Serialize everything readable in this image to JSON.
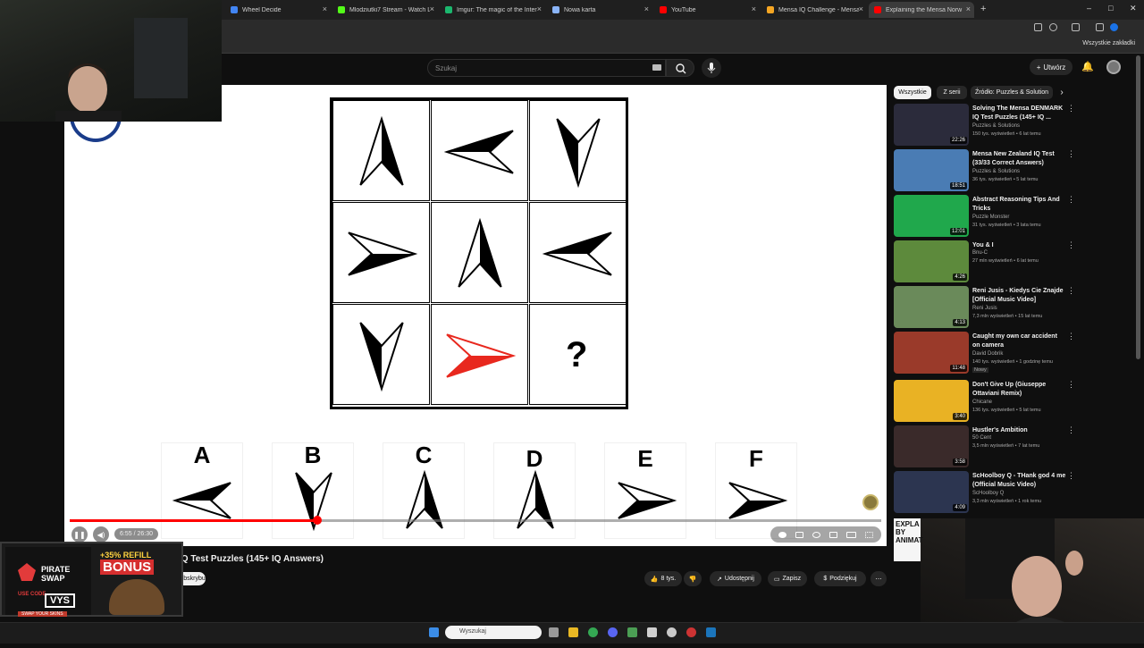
{
  "browser": {
    "tabs": [
      {
        "title": "Wheel Decide",
        "color": "#4285f4"
      },
      {
        "title": "Mlodziutki7 Stream - Watch Li",
        "color": "#53fc18"
      },
      {
        "title": "Imgur: The magic of the Intern",
        "color": "#1bb76e"
      },
      {
        "title": "Nowa karta",
        "color": "#8ab4f8"
      },
      {
        "title": "YouTube",
        "color": "#ff0000"
      },
      {
        "title": "Mensa IQ Challenge - Mensa I",
        "color": "#f5a623"
      },
      {
        "title": "Explaining the Mensa Norw",
        "color": "#ff0000"
      }
    ],
    "new_tab": "+",
    "window_controls": [
      "–",
      "□",
      "✕"
    ],
    "bookmarks_all": "Wszystkie zakładki"
  },
  "youtube": {
    "search_placeholder": "Szukaj",
    "create_label": "Utwórz",
    "create_icon": "+",
    "bell_icon": "🔔"
  },
  "player": {
    "time": "6:55 / 26:30",
    "progress": 0.305,
    "play_icon": "❚❚",
    "volume_icon": "◀)",
    "question_mark": "?",
    "options": [
      "A",
      "B",
      "C",
      "D",
      "E",
      "F"
    ],
    "accent_red": "#e8281e"
  },
  "video": {
    "title": "Mensa Norway IQ Test Puzzles (145+ IQ Answers)",
    "title_visible": "IQ Test Puzzles (145+ IQ Answers)",
    "subscribe": "Subskrybuj",
    "likes": "8 tys.",
    "dislike_icon": "👎",
    "like_icon": "👍",
    "share": "Udostępnij",
    "save": "Zapisz",
    "thanks": "Podziękuj",
    "more": "⋯"
  },
  "sidebar": {
    "chips": [
      "Wszystkie",
      "Z serii",
      "Źródło: Puzzles & Solution"
    ],
    "next_icon": "›",
    "items": [
      {
        "title": "Solving The Mensa DENMARK IQ Test Puzzles (145+ IQ ...",
        "channel": "Puzzles & Solutions",
        "meta": "150 tys. wyświetleń • 6 lat temu",
        "duration": "22:26",
        "thumb": "#2b2b3b"
      },
      {
        "title": "Mensa New Zealand IQ Test (33/33 Correct Answers)",
        "channel": "Puzzles & Solutions",
        "meta": "36 tys. wyświetleń • 5 lat temu",
        "duration": "18:51",
        "thumb": "#4a7cb4"
      },
      {
        "title": "Abstract Reasoning Tips And Tricks",
        "channel": "Puzzle Monster",
        "meta": "31 tys. wyświetleń • 3 lata temu",
        "duration": "12:01",
        "thumb": "#20a84c"
      },
      {
        "title": "You & I",
        "channel": "Bnu-C",
        "meta": "27 mln wyświetleń • 6 lat temu",
        "duration": "4:26",
        "thumb": "#5d8a3c"
      },
      {
        "title": "Reni Jusis - Kiedys Cie Znajde [Official Music Video]",
        "channel": "Reni Jusis",
        "meta": "7,3 mln wyświetleń • 15 lat temu",
        "duration": "4:13",
        "thumb": "#6a8a5a"
      },
      {
        "title": "Caught my own car accident on camera",
        "channel": "David Dobrik",
        "meta": "140 tys. wyświetleń • 1 godzinę temu",
        "duration": "11:48",
        "badge": "Nowy",
        "thumb": "#9a3a2a"
      },
      {
        "title": "Don't Give Up (Giuseppe Ottaviani Remix)",
        "channel": "Chicane",
        "meta": "136 tys. wyświetleń • 5 lat temu",
        "duration": "3:40",
        "thumb": "#e9b224"
      },
      {
        "title": "Hustler's Ambition",
        "channel": "50 Cent",
        "meta": "3,5 mln wyświetleń • 7 lat temu",
        "duration": "3:58",
        "thumb": "#3a2a2a"
      },
      {
        "title": "ScHoolboy Q - THank god 4 me (Official Music Video)",
        "channel": "ScHoolboy Q",
        "meta": "3,3 mln wyświetleń • 1 rok temu",
        "duration": "4:09",
        "thumb": "#2c3550"
      }
    ],
    "partial_text": "EXPLA BY ANIMAT"
  },
  "overlay": {
    "promo_brand1": "PIRATE",
    "promo_brand2": "SWAP",
    "promo_bonus_a": "+35% REFILL",
    "promo_bonus_b": "BONUS",
    "promo_code_label": "USE CODE",
    "promo_code": "VYS",
    "promo_tagline": "SWAP YOUR SKINS"
  },
  "taskbar": {
    "search_placeholder": "Wyszukaj",
    "icons": [
      "windows-start",
      "search",
      "file-explorer",
      "chrome",
      "discord",
      "teams",
      "spotify",
      "steam",
      "tray"
    ]
  }
}
